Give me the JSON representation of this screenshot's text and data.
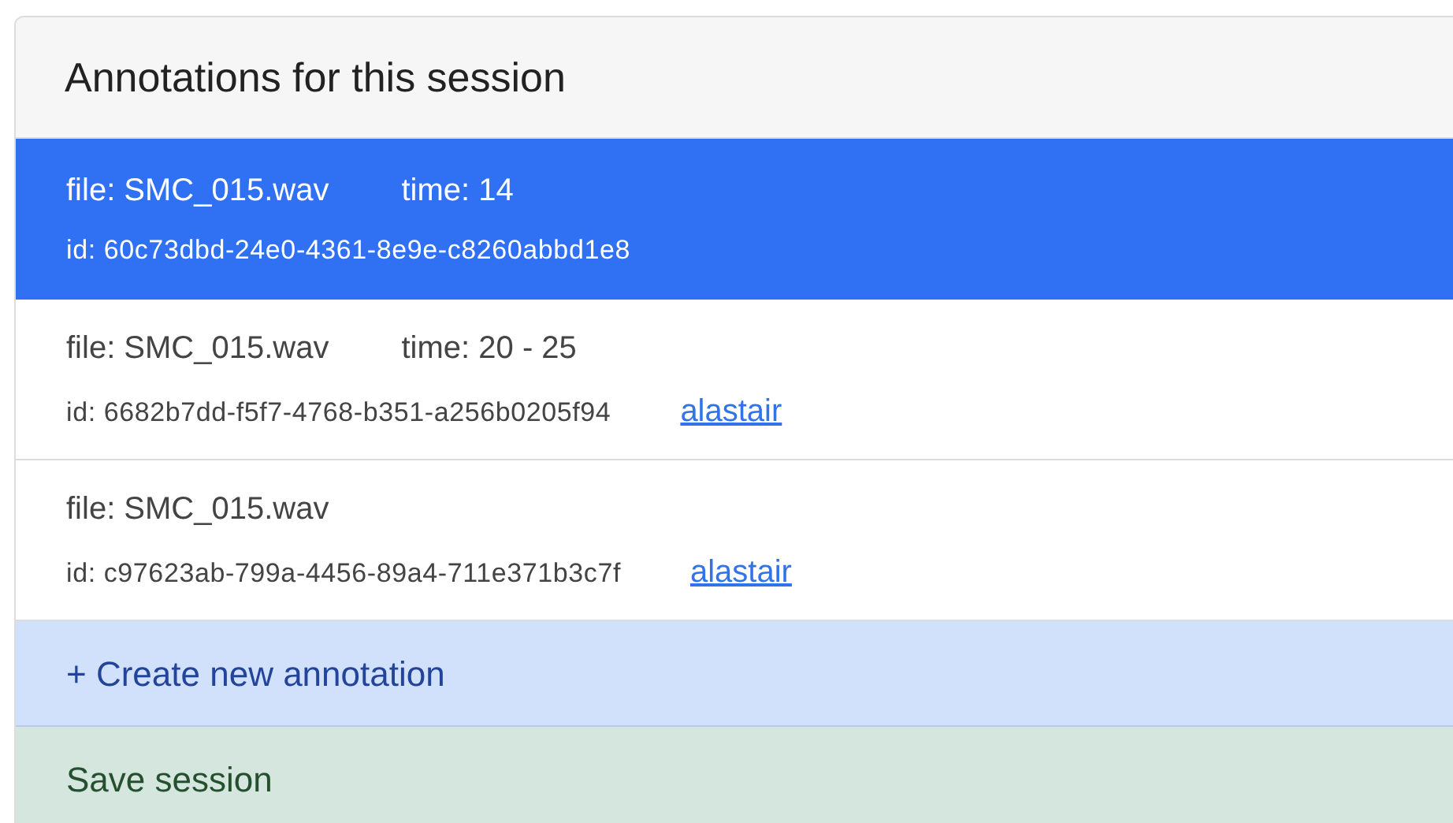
{
  "panel": {
    "title": "Annotations for this session"
  },
  "annotations": [
    {
      "file": "file: SMC_015.wav",
      "time": "time: 14",
      "id": "id: 60c73dbd-24e0-4361-8e9e-c8260abbd1e8",
      "selected": true
    },
    {
      "file": "file: SMC_015.wav",
      "time": "time: 20 - 25",
      "id": "id: 6682b7dd-f5f7-4768-b351-a256b0205f94",
      "author": "alastair",
      "selected": false
    },
    {
      "file": "file: SMC_015.wav",
      "id": "id: c97623ab-799a-4456-89a4-711e371b3c7f",
      "author": "alastair",
      "selected": false
    }
  ],
  "create_button": "+ Create new annotation",
  "save_button": "Save session"
}
